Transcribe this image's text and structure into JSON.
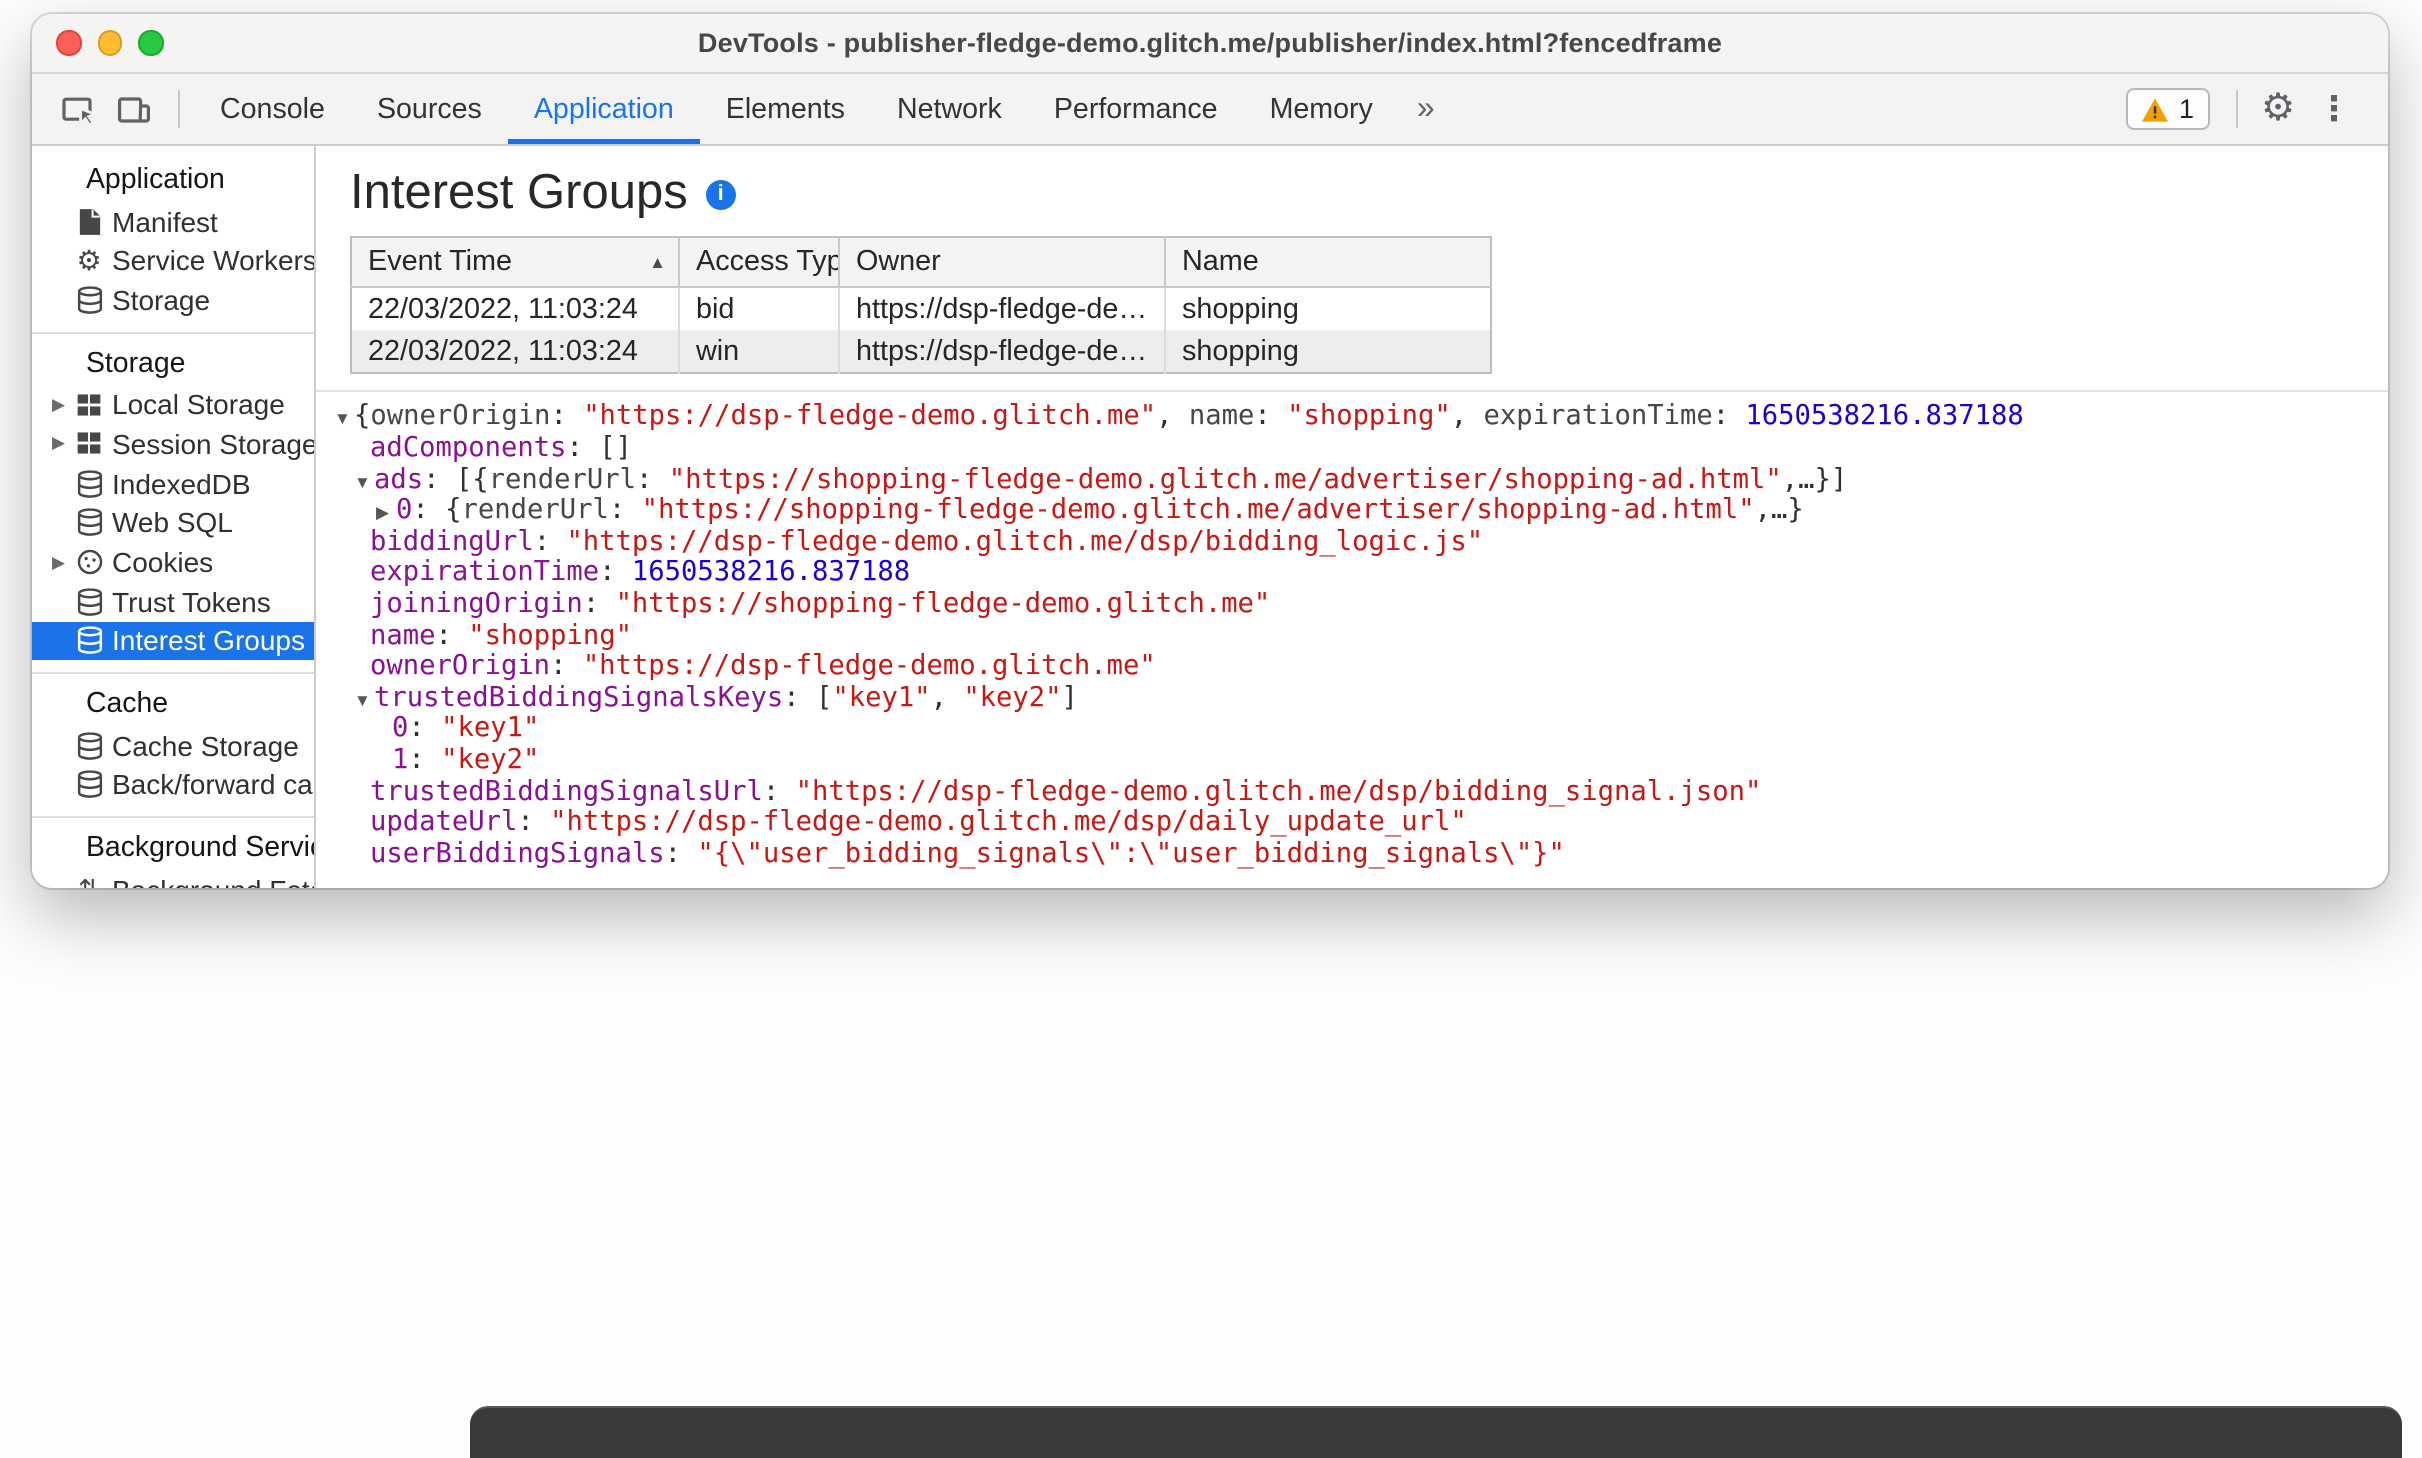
{
  "titlebar": {
    "title": "DevTools - publisher-fledge-demo.glitch.me/publisher/index.html?fencedframe"
  },
  "toolbar": {
    "tabs": [
      "Console",
      "Sources",
      "Application",
      "Elements",
      "Network",
      "Performance",
      "Memory"
    ],
    "active_tab": "Application",
    "overflow_chevron": "»",
    "warning_count": "1"
  },
  "sidebar": {
    "sections": [
      {
        "header": "Application",
        "items": [
          {
            "label": "Manifest",
            "icon": "document-icon"
          },
          {
            "label": "Service Workers",
            "icon": "gear-icon"
          },
          {
            "label": "Storage",
            "icon": "database-icon"
          }
        ]
      },
      {
        "header": "Storage",
        "items": [
          {
            "label": "Local Storage",
            "icon": "grid-icon",
            "expandable": true
          },
          {
            "label": "Session Storage",
            "icon": "grid-icon",
            "expandable": true
          },
          {
            "label": "IndexedDB",
            "icon": "database-icon"
          },
          {
            "label": "Web SQL",
            "icon": "database-icon"
          },
          {
            "label": "Cookies",
            "icon": "cookie-icon",
            "expandable": true
          },
          {
            "label": "Trust Tokens",
            "icon": "database-icon"
          },
          {
            "label": "Interest Groups",
            "icon": "database-icon",
            "selected": true
          }
        ]
      },
      {
        "header": "Cache",
        "items": [
          {
            "label": "Cache Storage",
            "icon": "database-icon"
          },
          {
            "label": "Back/forward cache",
            "icon": "database-icon"
          }
        ]
      },
      {
        "header": "Background Services",
        "items": [
          {
            "label": "Background Fetch",
            "icon": "fetch-icon"
          }
        ]
      }
    ]
  },
  "main": {
    "title": "Interest Groups",
    "table": {
      "columns": [
        {
          "label": "Event Time",
          "sort": "asc"
        },
        {
          "label": "Access Type"
        },
        {
          "label": "Owner"
        },
        {
          "label": "Name"
        }
      ],
      "rows": [
        [
          "22/03/2022, 11:03:24",
          "bid",
          "https://dsp-fledge-demo.glitch.me",
          "shopping"
        ],
        [
          "22/03/2022, 11:03:24",
          "win",
          "https://dsp-fledge-demo.glitch.me",
          "shopping"
        ]
      ]
    },
    "tree": {
      "lines": [
        {
          "pad": 9,
          "marker": "down",
          "segments": [
            [
              "plain",
              "{"
            ],
            [
              "key",
              "ownerOrigin"
            ],
            [
              "plain",
              ": "
            ],
            [
              "str",
              "\"https://dsp-fledge-demo.glitch.me\""
            ],
            [
              "plain",
              ", "
            ],
            [
              "key",
              "name"
            ],
            [
              "plain",
              ": "
            ],
            [
              "str",
              "\"shopping\""
            ],
            [
              "plain",
              ", "
            ],
            [
              "key",
              "expirationTime"
            ],
            [
              "plain",
              ": "
            ],
            [
              "num",
              "1650538216.837188"
            ]
          ]
        },
        {
          "pad": 27,
          "marker": "none",
          "segments": [
            [
              "prop",
              "adComponents"
            ],
            [
              "plain",
              ": "
            ],
            [
              "plain",
              "[]"
            ]
          ]
        },
        {
          "pad": 19,
          "marker": "down",
          "segments": [
            [
              "prop",
              "ads"
            ],
            [
              "plain",
              ": "
            ],
            [
              "plain",
              "[{"
            ],
            [
              "key",
              "renderUrl"
            ],
            [
              "plain",
              ": "
            ],
            [
              "str",
              "\"https://shopping-fledge-demo.glitch.me/advertiser/shopping-ad.html\""
            ],
            [
              "plain",
              ",…}]"
            ]
          ]
        },
        {
          "pad": 30,
          "marker": "right",
          "segments": [
            [
              "prop",
              "0"
            ],
            [
              "plain",
              ": {"
            ],
            [
              "key",
              "renderUrl"
            ],
            [
              "plain",
              ": "
            ],
            [
              "str",
              "\"https://shopping-fledge-demo.glitch.me/advertiser/shopping-ad.html\""
            ],
            [
              "plain",
              ",…}"
            ]
          ]
        },
        {
          "pad": 27,
          "marker": "none",
          "segments": [
            [
              "prop",
              "biddingUrl"
            ],
            [
              "plain",
              ": "
            ],
            [
              "str",
              "\"https://dsp-fledge-demo.glitch.me/dsp/bidding_logic.js\""
            ]
          ]
        },
        {
          "pad": 27,
          "marker": "none",
          "segments": [
            [
              "prop",
              "expirationTime"
            ],
            [
              "plain",
              ": "
            ],
            [
              "num",
              "1650538216.837188"
            ]
          ]
        },
        {
          "pad": 27,
          "marker": "none",
          "segments": [
            [
              "prop",
              "joiningOrigin"
            ],
            [
              "plain",
              ": "
            ],
            [
              "str",
              "\"https://shopping-fledge-demo.glitch.me\""
            ]
          ]
        },
        {
          "pad": 27,
          "marker": "none",
          "segments": [
            [
              "prop",
              "name"
            ],
            [
              "plain",
              ": "
            ],
            [
              "str",
              "\"shopping\""
            ]
          ]
        },
        {
          "pad": 27,
          "marker": "none",
          "segments": [
            [
              "prop",
              "ownerOrigin"
            ],
            [
              "plain",
              ": "
            ],
            [
              "str",
              "\"https://dsp-fledge-demo.glitch.me\""
            ]
          ]
        },
        {
          "pad": 19,
          "marker": "down",
          "segments": [
            [
              "prop",
              "trustedBiddingSignalsKeys"
            ],
            [
              "plain",
              ": "
            ],
            [
              "plain",
              "["
            ],
            [
              "str",
              "\"key1\""
            ],
            [
              "plain",
              ", "
            ],
            [
              "str",
              "\"key2\""
            ],
            [
              "plain",
              "]"
            ]
          ]
        },
        {
          "pad": 38,
          "marker": "none",
          "segments": [
            [
              "prop",
              "0"
            ],
            [
              "plain",
              ": "
            ],
            [
              "str",
              "\"key1\""
            ]
          ]
        },
        {
          "pad": 38,
          "marker": "none",
          "segments": [
            [
              "prop",
              "1"
            ],
            [
              "plain",
              ": "
            ],
            [
              "str",
              "\"key2\""
            ]
          ]
        },
        {
          "pad": 27,
          "marker": "none",
          "segments": [
            [
              "prop",
              "trustedBiddingSignalsUrl"
            ],
            [
              "plain",
              ": "
            ],
            [
              "str",
              "\"https://dsp-fledge-demo.glitch.me/dsp/bidding_signal.json\""
            ]
          ]
        },
        {
          "pad": 27,
          "marker": "none",
          "segments": [
            [
              "prop",
              "updateUrl"
            ],
            [
              "plain",
              ": "
            ],
            [
              "str",
              "\"https://dsp-fledge-demo.glitch.me/dsp/daily_update_url\""
            ]
          ]
        },
        {
          "pad": 27,
          "marker": "none",
          "segments": [
            [
              "prop",
              "userBiddingSignals"
            ],
            [
              "plain",
              ": "
            ],
            [
              "str",
              "\"{\\\"user_bidding_signals\\\":\\\"user_bidding_signals\\\"}\""
            ]
          ]
        }
      ]
    }
  },
  "colors": {
    "accent": "#1a73e8",
    "selected_row": "#1a73e8",
    "json_property": "#881391",
    "json_string": "#c41a16",
    "json_number": "#1c00cf",
    "warning": "#f0a000"
  }
}
